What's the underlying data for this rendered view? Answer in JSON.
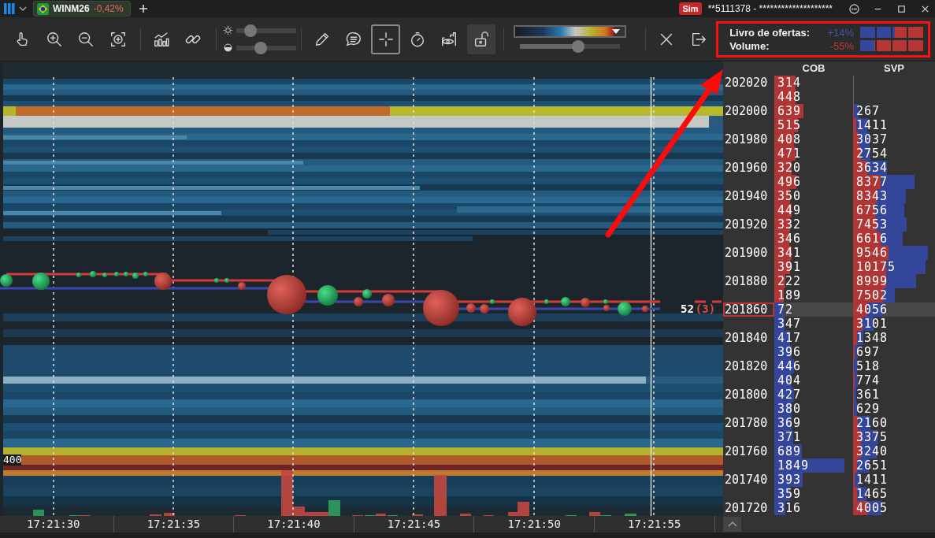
{
  "top_bar": {
    "tab": {
      "symbol": "WINM26",
      "change": "-0,42%"
    },
    "badge": "Sim",
    "account": "**5111378 - ********************"
  },
  "toolbar": {
    "navigation": [
      {
        "kind": "hand",
        "selected": false
      },
      {
        "kind": "zoom-in",
        "selected": false
      },
      {
        "kind": "zoom-out",
        "selected": false
      },
      {
        "kind": "zoom-fit",
        "selected": false
      }
    ],
    "chart": [
      {
        "kind": "chart",
        "selected": false
      },
      {
        "kind": "link",
        "selected": false
      }
    ],
    "sliders": [
      {
        "kind": "brightness",
        "level": 0.24
      },
      {
        "kind": "contrast",
        "level": 0.42
      }
    ],
    "drawing": [
      {
        "kind": "pencil",
        "selected": false
      },
      {
        "kind": "comment",
        "selected": false
      },
      {
        "kind": "crosshair",
        "selected": true
      },
      {
        "kind": "stopwatch",
        "selected": false
      },
      {
        "kind": "eye-chart",
        "selected": false
      },
      {
        "kind": "unlock",
        "selected": true
      }
    ],
    "color_scale": {
      "level": 0.58
    },
    "actions": [
      {
        "kind": "close"
      },
      {
        "kind": "export"
      }
    ],
    "indicators": [
      {
        "label": "Livro de ofertas:",
        "value": "+14%",
        "color": "#3f58b0",
        "level": 0.55
      },
      {
        "label": "Volume:",
        "value": "-55%",
        "color": "#c23a3a",
        "level": 0.22
      }
    ]
  },
  "heatmap": {
    "level_label": "400",
    "last_price": {
      "size": "52",
      "count": "(3)"
    },
    "time_labels": [
      "17:21:30",
      "17:21:35",
      "17:21:40",
      "17:21:45",
      "17:21:50",
      "17:21:55"
    ]
  },
  "ladder": {
    "columns": [
      "COB",
      "SVP"
    ],
    "rows": [
      {
        "price": "202020",
        "selected": false,
        "cob": "314",
        "color": "#b03636"
      },
      {
        "selected": false,
        "cob": "448",
        "color": "#b03636"
      },
      {
        "price": "202000",
        "selected": false,
        "cob": "639",
        "color": "#b03636",
        "svp": "267"
      },
      {
        "selected": false,
        "cob": "515",
        "color": "#b03636",
        "svp": "1411"
      },
      {
        "price": "201980",
        "selected": false,
        "cob": "408",
        "color": "#b03636",
        "svp": "3037"
      },
      {
        "selected": false,
        "cob": "471",
        "color": "#b03636",
        "svp": "2754"
      },
      {
        "price": "201960",
        "selected": false,
        "cob": "320",
        "color": "#b03636",
        "svp": "3634"
      },
      {
        "selected": false,
        "cob": "496",
        "color": "#b03636",
        "svp": "8377"
      },
      {
        "price": "201940",
        "selected": false,
        "cob": "350",
        "color": "#b03636",
        "svp": "8343"
      },
      {
        "selected": false,
        "cob": "449",
        "color": "#b03636",
        "svp": "6756"
      },
      {
        "price": "201920",
        "selected": false,
        "cob": "332",
        "color": "#b03636",
        "svp": "7453"
      },
      {
        "selected": false,
        "cob": "346",
        "color": "#b03636",
        "svp": "6616"
      },
      {
        "price": "201900",
        "selected": false,
        "cob": "341",
        "color": "#b03636",
        "svp": "9546"
      },
      {
        "selected": false,
        "cob": "391",
        "color": "#b03636",
        "svp": "10175"
      },
      {
        "price": "201880",
        "selected": false,
        "cob": "222",
        "color": "#b03636",
        "svp": "8999"
      },
      {
        "selected": false,
        "cob": "189",
        "color": "#b03636",
        "svp": "7502"
      },
      {
        "price": "201860",
        "selected": true,
        "cob": "72",
        "color": "#34469a",
        "svp": "4056"
      },
      {
        "selected": false,
        "cob": "347",
        "color": "#34469a",
        "svp": "3101"
      },
      {
        "price": "201840",
        "selected": false,
        "cob": "417",
        "color": "#34469a",
        "svp": "1348"
      },
      {
        "selected": false,
        "cob": "396",
        "color": "#34469a",
        "svp": "697"
      },
      {
        "price": "201820",
        "selected": false,
        "cob": "446",
        "color": "#34469a",
        "svp": "518"
      },
      {
        "selected": false,
        "cob": "404",
        "color": "#34469a",
        "svp": "774"
      },
      {
        "price": "201800",
        "selected": false,
        "cob": "427",
        "color": "#34469a",
        "svp": "361"
      },
      {
        "selected": false,
        "cob": "380",
        "color": "#34469a",
        "svp": "629"
      },
      {
        "price": "201780",
        "selected": false,
        "cob": "369",
        "color": "#34469a",
        "svp": "2160"
      },
      {
        "selected": false,
        "cob": "371",
        "color": "#34469a",
        "svp": "3375"
      },
      {
        "price": "201760",
        "selected": false,
        "cob": "689",
        "color": "#34469a",
        "svp": "3240"
      },
      {
        "selected": false,
        "cob": "1849",
        "color": "#34469a",
        "svp": "2651"
      },
      {
        "price": "201740",
        "selected": false,
        "cob": "393",
        "color": "#34469a",
        "svp": "1411"
      },
      {
        "selected": false,
        "cob": "359",
        "color": "#34469a",
        "svp": "1465"
      },
      {
        "price": "201720",
        "selected": false,
        "cob": "316",
        "color": "#34469a",
        "svp": "4005"
      }
    ]
  }
}
